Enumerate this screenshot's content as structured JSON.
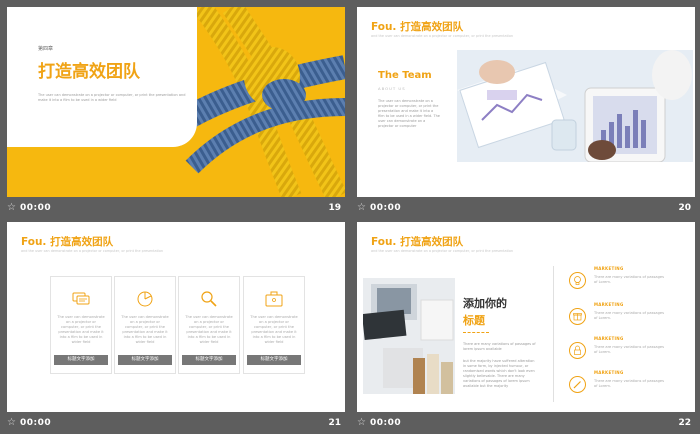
{
  "colors": {
    "accent": "#f0a315",
    "background": "#5e5e5e",
    "card_label": "#777777"
  },
  "slides": [
    {
      "number": "19",
      "time": "00:00",
      "chapter": "第四章",
      "title": "打造高效团队",
      "desc": "The user can demonstrate on a projector or computer, or print the presentation and make it into a film to be used in a wider field"
    },
    {
      "number": "20",
      "time": "00:00",
      "header": "Fou. 打造高效团队",
      "header_sub": "and the user can demonstrate on a projector or computer, or print the presentation",
      "team_title": "The Team",
      "team_sub": "ABOUT US",
      "team_desc": "The user can demonstrate on a projector or computer, or print the presentation and make it into a film to be used in a wider field. The user can demonstrate on a projector or computer"
    },
    {
      "number": "21",
      "time": "00:00",
      "header": "Fou. 打造高效团队",
      "header_sub": "and the user can demonstrate on a projector or computer, or print the presentation",
      "cards": [
        {
          "icon": "chat-icon",
          "text": "The user can demonstrate on a projector or computer, or print the presentation and make it into a film to be used in wider field",
          "label": "标题文字添加"
        },
        {
          "icon": "pie-chart-icon",
          "text": "The user can demonstrate on a projector or computer, or print the presentation and make it into a film to be used in wider field",
          "label": "标题文字添加"
        },
        {
          "icon": "search-icon",
          "text": "The user can demonstrate on a projector or computer, or print the presentation and make it into a film to be used in wider field",
          "label": "标题文字添加"
        },
        {
          "icon": "briefcase-icon",
          "text": "The user can demonstrate on a projector or computer, or print the presentation and make it into a film to be used in wider field",
          "label": "标题文字添加"
        }
      ]
    },
    {
      "number": "22",
      "time": "00:00",
      "header": "Fou. 打造高效团队",
      "header_sub": "and the user can demonstrate on a projector or computer, or print the presentation",
      "main_title_1": "添加你的",
      "main_title_2": "标题",
      "body_1": "There are many variations of passages of lorem ipsum available",
      "body_2": "but the majority have suffered alteration in some form, by injected humour, or randomised words which don't look even slightly believable. There are many variations of passages of lorem ipsum available but the majority",
      "marketing": [
        {
          "icon": "bulb-icon",
          "title": "MARKETING",
          "desc": "There are many variations of passages of Lorem."
        },
        {
          "icon": "gift-icon",
          "title": "MARKETING",
          "desc": "There are many variations of passages of Lorem."
        },
        {
          "icon": "lock-icon",
          "title": "MARKETING",
          "desc": "There are many variations of passages of Lorem."
        },
        {
          "icon": "pen-icon",
          "title": "MARKETING",
          "desc": "There are many variations of passages of Lorem."
        }
      ]
    }
  ]
}
